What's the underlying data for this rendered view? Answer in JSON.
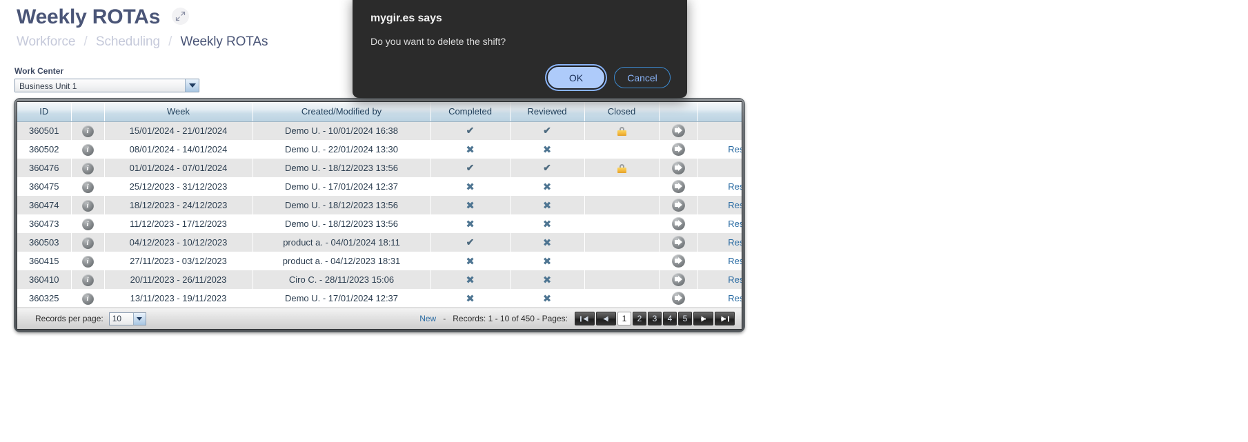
{
  "header": {
    "title": "Weekly ROTAs",
    "expand_icon": "expand-arrows-icon",
    "breadcrumb": [
      "Workforce",
      "Scheduling",
      "Weekly ROTAs"
    ],
    "breadcrumb_sep": "/"
  },
  "filters": {
    "work_center_label": "Work Center",
    "work_center_value": "Business Unit 1",
    "dropdown_icon": "chevron-down-icon"
  },
  "table": {
    "columns": [
      "ID",
      "",
      "Week",
      "Created/Modified by",
      "Completed",
      "Reviewed",
      "Closed",
      "",
      ""
    ],
    "rows": [
      {
        "id": "360501",
        "info": "i",
        "week": "15/01/2024 - 21/01/2024",
        "author": "Demo U. - 10/01/2024 16:38",
        "completed": "check",
        "reviewed": "check",
        "closed": "lock",
        "go": "go-arrow-icon",
        "restart": ""
      },
      {
        "id": "360502",
        "info": "i",
        "week": "08/01/2024 - 14/01/2024",
        "author": "Demo U. - 22/01/2024 13:30",
        "completed": "cross",
        "reviewed": "cross",
        "closed": "",
        "go": "go-arrow-icon",
        "restart": "Restart"
      },
      {
        "id": "360476",
        "info": "i",
        "week": "01/01/2024 - 07/01/2024",
        "author": "Demo U. - 18/12/2023 13:56",
        "completed": "check",
        "reviewed": "check",
        "closed": "lock",
        "go": "go-arrow-icon",
        "restart": ""
      },
      {
        "id": "360475",
        "info": "i",
        "week": "25/12/2023 - 31/12/2023",
        "author": "Demo U. - 17/01/2024 12:37",
        "completed": "cross",
        "reviewed": "cross",
        "closed": "",
        "go": "go-arrow-icon",
        "restart": "Restart"
      },
      {
        "id": "360474",
        "info": "i",
        "week": "18/12/2023 - 24/12/2023",
        "author": "Demo U. - 18/12/2023 13:56",
        "completed": "cross",
        "reviewed": "cross",
        "closed": "",
        "go": "go-arrow-icon",
        "restart": "Restart"
      },
      {
        "id": "360473",
        "info": "i",
        "week": "11/12/2023 - 17/12/2023",
        "author": "Demo U. - 18/12/2023 13:56",
        "completed": "cross",
        "reviewed": "cross",
        "closed": "",
        "go": "go-arrow-icon",
        "restart": "Restart"
      },
      {
        "id": "360503",
        "info": "i",
        "week": "04/12/2023 - 10/12/2023",
        "author": "product a. - 04/01/2024 18:11",
        "completed": "check",
        "reviewed": "cross",
        "closed": "",
        "go": "go-arrow-icon",
        "restart": "Restart"
      },
      {
        "id": "360415",
        "info": "i",
        "week": "27/11/2023 - 03/12/2023",
        "author": "product a. - 04/12/2023 18:31",
        "completed": "cross",
        "reviewed": "cross",
        "closed": "",
        "go": "go-arrow-icon",
        "restart": "Restart"
      },
      {
        "id": "360410",
        "info": "i",
        "week": "20/11/2023 - 26/11/2023",
        "author": "Ciro C. - 28/11/2023 15:06",
        "completed": "cross",
        "reviewed": "cross",
        "closed": "",
        "go": "go-arrow-icon",
        "restart": "Restart"
      },
      {
        "id": "360325",
        "info": "i",
        "week": "13/11/2023 - 19/11/2023",
        "author": "Demo U. - 17/01/2024 12:37",
        "completed": "cross",
        "reviewed": "cross",
        "closed": "",
        "go": "go-arrow-icon",
        "restart": "Restart"
      }
    ]
  },
  "footer": {
    "records_per_page_label": "Records per page:",
    "records_per_page_value": "10",
    "new_label": "New",
    "separator": "-",
    "records_text": "Records: 1 - 10 of 450 - Pages:",
    "pages": [
      "1",
      "2",
      "3",
      "4",
      "5"
    ],
    "current_page": "1",
    "nav_first_icon": "first-page-icon",
    "nav_prev_icon": "prev-page-icon",
    "nav_next_icon": "next-page-icon",
    "nav_last_icon": "last-page-icon"
  },
  "dialog": {
    "title": "mygir.es says",
    "message": "Do you want to delete the shift?",
    "ok_label": "OK",
    "cancel_label": "Cancel"
  },
  "colors": {
    "accent": "#4a5577",
    "link": "#2b6ca3",
    "dialog_bg": "#2b2b2b",
    "dialog_ok_bg": "#aecbfa",
    "dialog_cancel_fg": "#8ab4f8",
    "lock_yellow": "#f3b73c"
  }
}
